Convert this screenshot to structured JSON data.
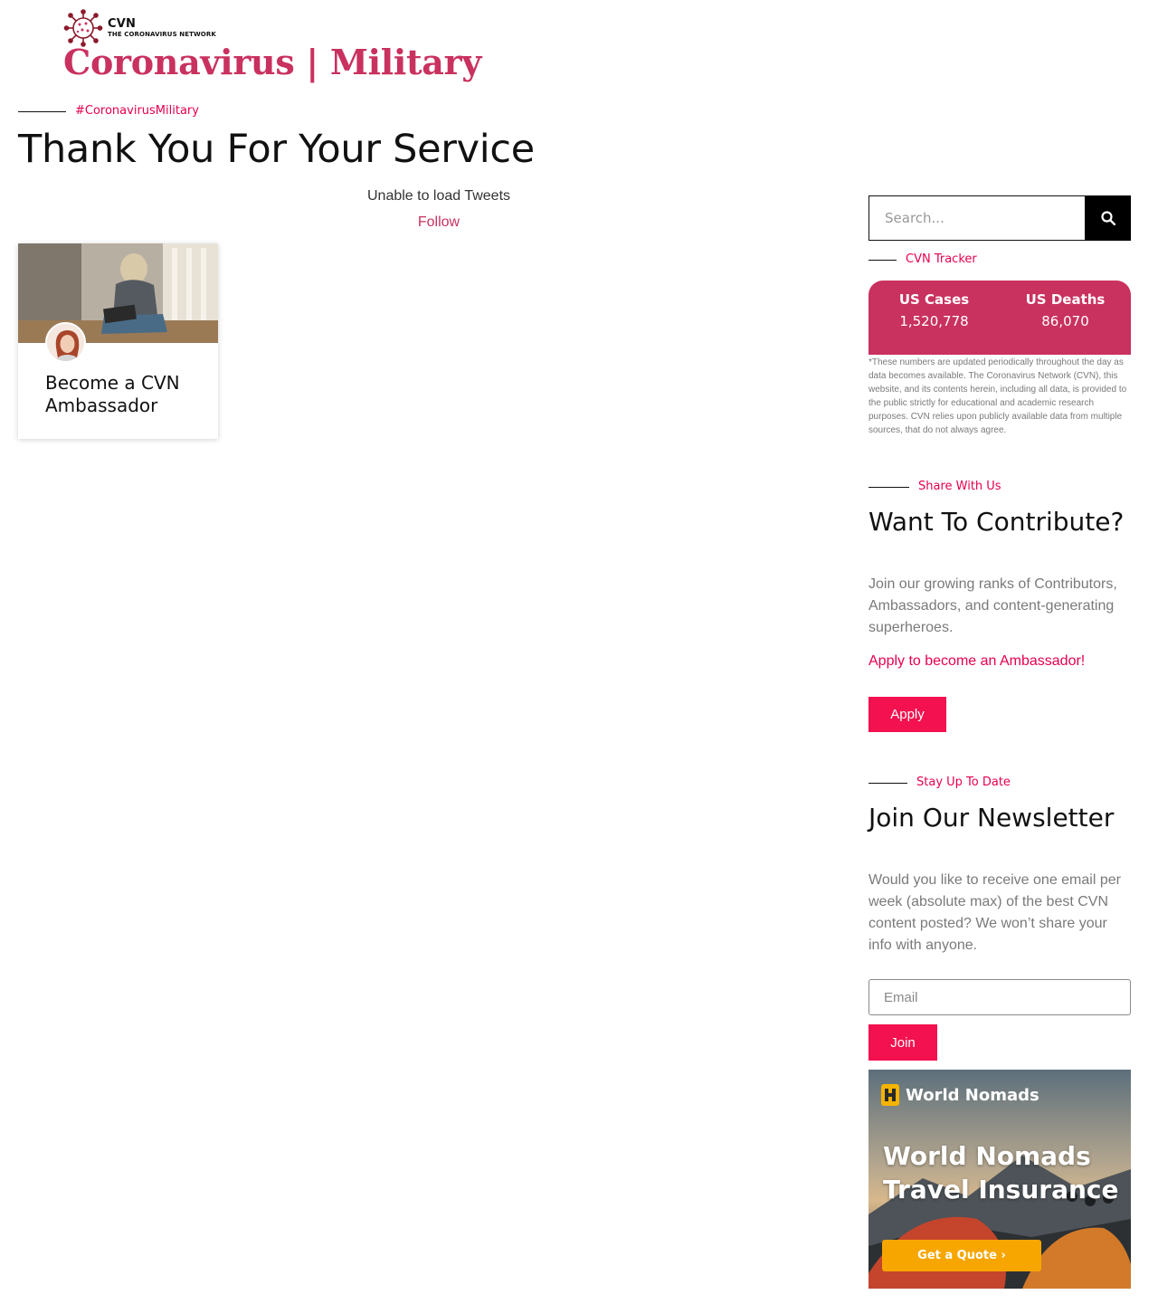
{
  "header": {
    "logo_name": "CVN",
    "logo_tagline": "THE CORONAVIRUS NETWORK",
    "site_title": "Coronavirus | Military"
  },
  "main": {
    "hashtag": "#CoronavirusMilitary",
    "page_title": "Thank You For Your Service",
    "tweets": {
      "message": "Unable to load Tweets",
      "follow_label": "Follow"
    },
    "card": {
      "title": "Become a CVN Ambassador"
    }
  },
  "sidebar": {
    "search": {
      "placeholder": "Search..."
    },
    "tracker": {
      "label": "CVN Tracker",
      "cases_label": "US Cases",
      "cases_value": "1,520,778",
      "deaths_label": "US Deaths",
      "deaths_value": "86,070",
      "disclaimer": "*These numbers are updated periodically throughout the day as data becomes available. The Coronavirus Network (CVN), this website, and its contents herein, including all data, is provided to the public strictly for educational and academic research purposes. CVN relies upon publicly available data from multiple sources, that do not always agree."
    },
    "contribute": {
      "label": "Share With Us",
      "heading": "Want To Contribute?",
      "text": "Join our growing ranks of Contributors, Ambassadors, and content-generating superheroes.",
      "link": "Apply to become an Ambassador!",
      "button": "Apply"
    },
    "newsletter": {
      "label": "Stay Up To Date",
      "heading": "Join Our Newsletter",
      "text": "Would you like to receive one email per week (absolute max) of the best CVN content posted? We won’t share your info with anyone.",
      "email_placeholder": "Email",
      "button": "Join"
    },
    "ad": {
      "brand": "World Nomads",
      "headline_line1": "World Nomads",
      "headline_line2": "Travel Insurance",
      "button": "Get a Quote ›"
    }
  },
  "colors": {
    "brand_pink": "#c9315f",
    "accent_pink": "#e6004d",
    "button_pink": "#f3114f",
    "ad_orange": "#f7a600"
  }
}
